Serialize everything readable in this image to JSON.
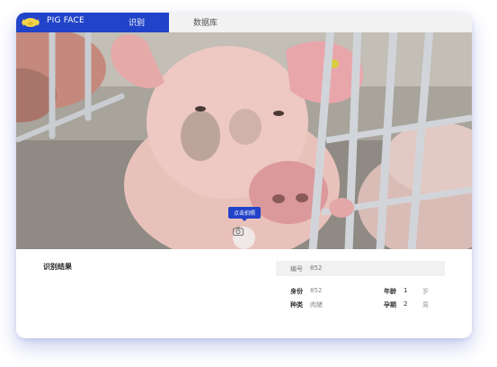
{
  "header": {
    "brand": "PIG FACE",
    "nav_recognize": "识别",
    "nav_database": "数据库"
  },
  "camera": {
    "capture_label": "点击拍照"
  },
  "result": {
    "title": "识别结果",
    "id_label": "编号",
    "id_value": "852",
    "identity_label": "身份",
    "identity_value": "852",
    "age_label": "年龄",
    "age_value": "1",
    "age_unit": "岁",
    "breed_label": "种类",
    "breed_value": "肉猪",
    "pregnancy_label": "孕期",
    "pregnancy_value": "2",
    "pregnancy_unit": "周"
  },
  "colors": {
    "brand_blue": "#2143c9",
    "topbar_bg": "#f2f2f2"
  },
  "icons": {
    "logo": "pig-icon",
    "camera": "camera-icon"
  }
}
